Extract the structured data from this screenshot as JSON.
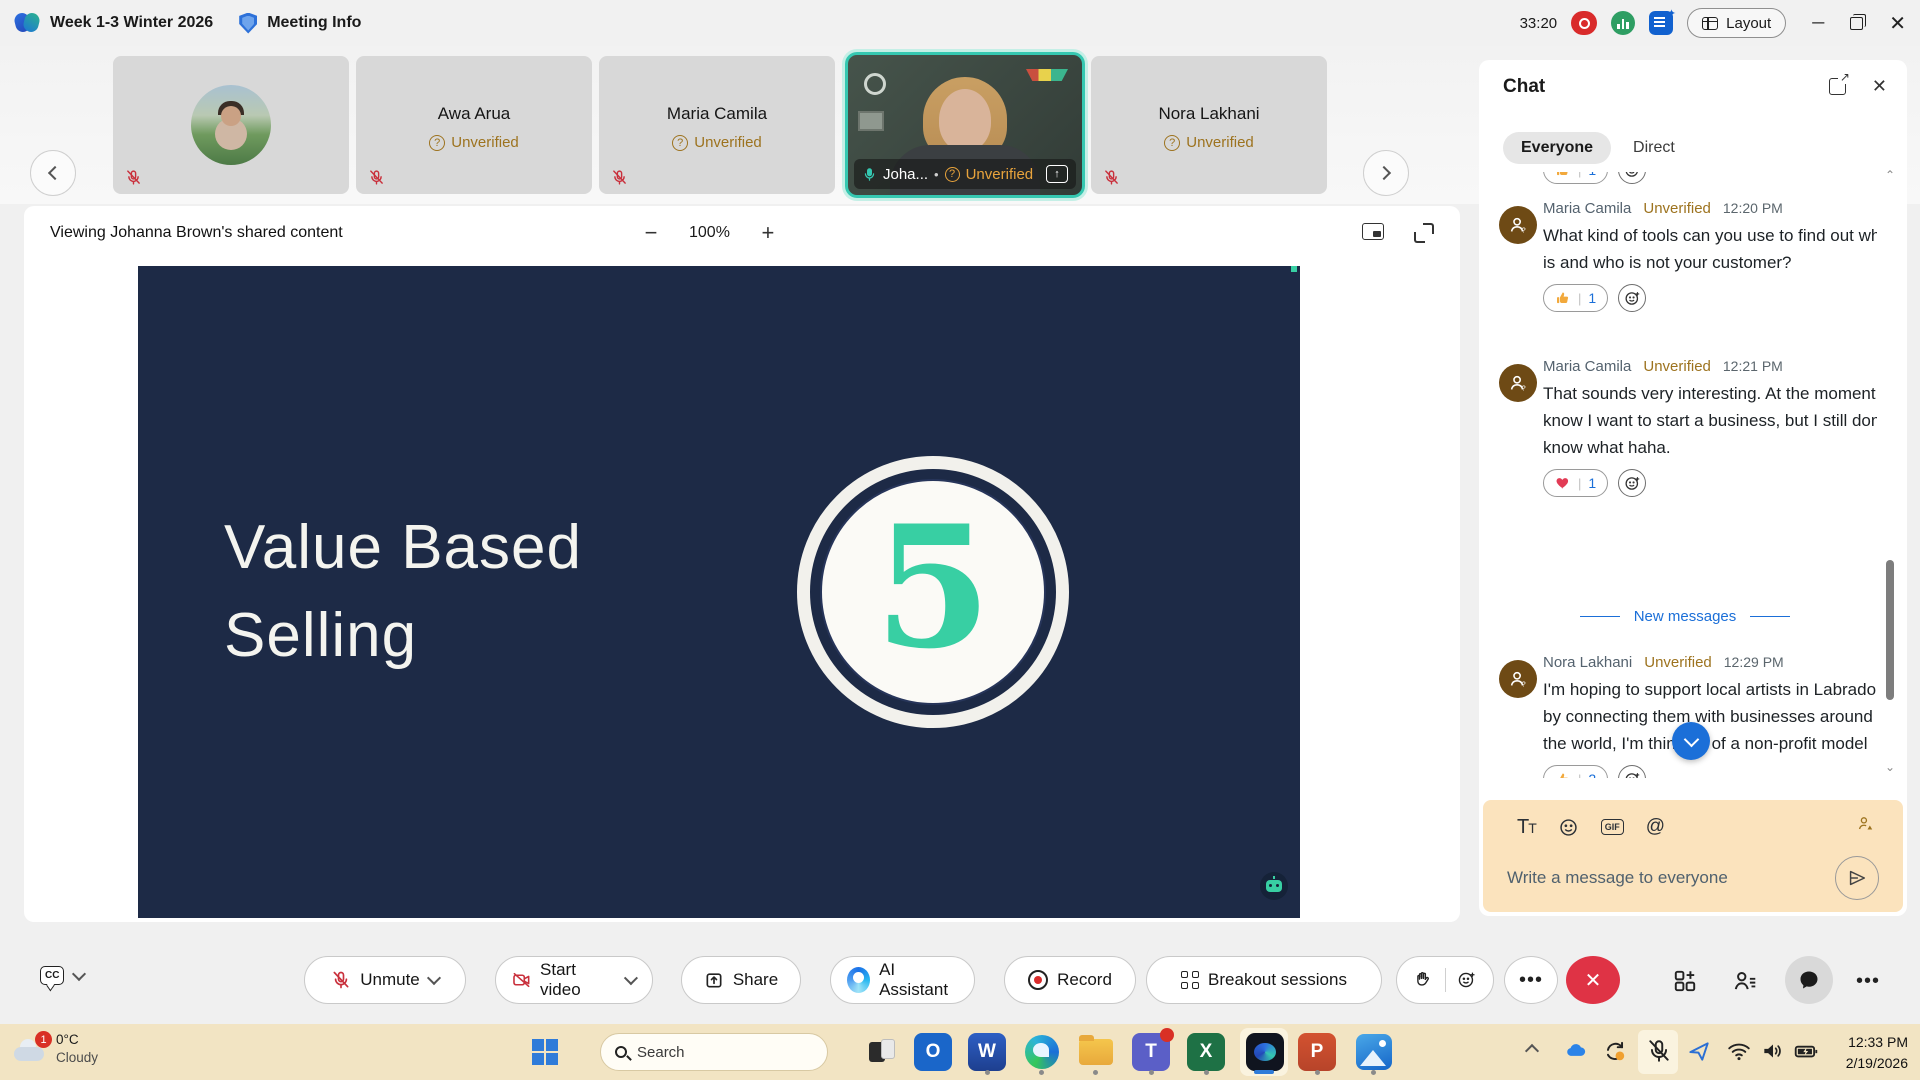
{
  "colors": {
    "accent_teal": "#35c8b1",
    "unverified_amber": "#9d731f",
    "link_blue": "#1b6fd8",
    "leave_red": "#df3345",
    "slide_bg": "#1d2a46",
    "slide_accent": "#38cfa3",
    "composer_bg": "#fbe3bd",
    "taskbar_bg": "#f2e4c3"
  },
  "titlebar": {
    "meeting_title": "Week 1-3 Winter 2026",
    "meeting_info": "Meeting Info",
    "timer": "33:20",
    "layout_label": "Layout"
  },
  "strip": {
    "tiles": [
      {
        "name": "",
        "status": ""
      },
      {
        "name": "Awa Arua",
        "status": "Unverified"
      },
      {
        "name": "Maria Camila",
        "status": "Unverified"
      },
      {
        "name": "Joha...",
        "status": "Unverified"
      },
      {
        "name": "Nora Lakhani",
        "status": "Unverified"
      }
    ]
  },
  "stage": {
    "viewing_label": "Viewing Johanna Brown's shared content",
    "zoom_value": "100%",
    "slide": {
      "line1": "Value Based",
      "line2": "Selling",
      "number": "5"
    }
  },
  "chat": {
    "title": "Chat",
    "tab_everyone": "Everyone",
    "tab_direct": "Direct",
    "partial_reaction_count": "1",
    "messages": [
      {
        "author": "Maria Camila",
        "status": "Unverified",
        "time": "12:20 PM",
        "text": "What kind of tools can you use to find out who is and who is not your customer?",
        "reaction": "thumbs-up",
        "reaction_count": "1"
      },
      {
        "author": "Maria Camila",
        "status": "Unverified",
        "time": "12:21 PM",
        "text": "That sounds very interesting. At the moment, I know I want to start a business, but I still don't know what haha.",
        "reaction": "heart",
        "reaction_count": "1"
      },
      {
        "author": "Nora Lakhani",
        "status": "Unverified",
        "time": "12:29 PM",
        "text": "I'm hoping to support local artists in Labrador by connecting them with businesses around the world, I'm thinking of a non-profit model",
        "reaction": "thumbs-up",
        "reaction_count": "2"
      }
    ],
    "new_messages_label": "New messages",
    "composer_placeholder": "Write a message to everyone"
  },
  "controls": {
    "unmute": "Unmute",
    "start_video": "Start video",
    "share": "Share",
    "ai_assistant": "AI Assistant",
    "record": "Record",
    "breakout": "Breakout sessions"
  },
  "icons": {
    "cc": "CC",
    "gif": "GIF",
    "at": "@",
    "tt": "Tt"
  },
  "taskbar": {
    "weather_temp": "0°C",
    "weather_condition": "Cloudy",
    "notification_badge": "1",
    "search_placeholder": "Search",
    "time": "12:33 PM",
    "date": "2/19/2026"
  }
}
